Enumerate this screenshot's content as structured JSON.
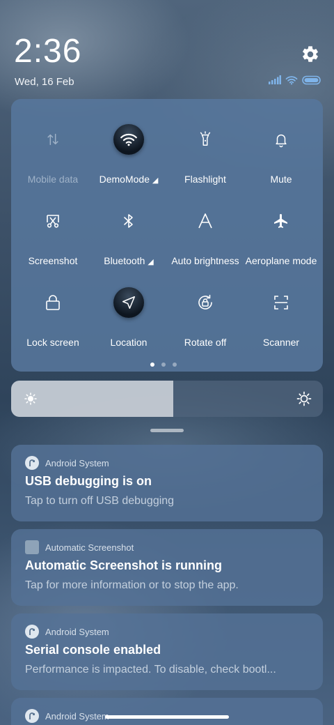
{
  "header": {
    "time": "2:36",
    "date": "Wed, 16 Feb"
  },
  "icons": {
    "settings": "gear-icon",
    "signal": "signal-icon",
    "wifi": "wifi-icon",
    "battery": "battery-icon"
  },
  "quick_settings": {
    "tiles": [
      {
        "label": "Mobile data",
        "icon": "mobile-data-icon",
        "state": "disabled"
      },
      {
        "label": "DemoMode",
        "icon": "wifi-icon",
        "state": "active"
      },
      {
        "label": "Flashlight",
        "icon": "flashlight-icon",
        "state": "off"
      },
      {
        "label": "Mute",
        "icon": "bell-icon",
        "state": "off"
      },
      {
        "label": "Screenshot",
        "icon": "scissors-icon",
        "state": "off"
      },
      {
        "label": "Bluetooth",
        "icon": "bluetooth-icon",
        "state": "off"
      },
      {
        "label": "Auto brightness",
        "icon": "auto-brightness-icon",
        "state": "off"
      },
      {
        "label": "Aeroplane mode",
        "icon": "airplane-icon",
        "state": "off"
      },
      {
        "label": "Lock screen",
        "icon": "lock-icon",
        "state": "off"
      },
      {
        "label": "Location",
        "icon": "location-icon",
        "state": "active"
      },
      {
        "label": "Rotate off",
        "icon": "rotate-lock-icon",
        "state": "off"
      },
      {
        "label": "Scanner",
        "icon": "scanner-icon",
        "state": "off"
      }
    ],
    "page_count": 3,
    "current_page": 1
  },
  "brightness": {
    "level": 0.52
  },
  "notifications": [
    {
      "app": "Android System",
      "title": "USB debugging is on",
      "body": "Tap to turn off USB debugging"
    },
    {
      "app": "Automatic Screenshot",
      "title": "Automatic Screenshot is running",
      "body": "Tap for more information or to stop the app."
    },
    {
      "app": "Android System",
      "title": "Serial console enabled",
      "body": "Performance is impacted. To disable, check bootl..."
    },
    {
      "app": "Android System"
    }
  ]
}
